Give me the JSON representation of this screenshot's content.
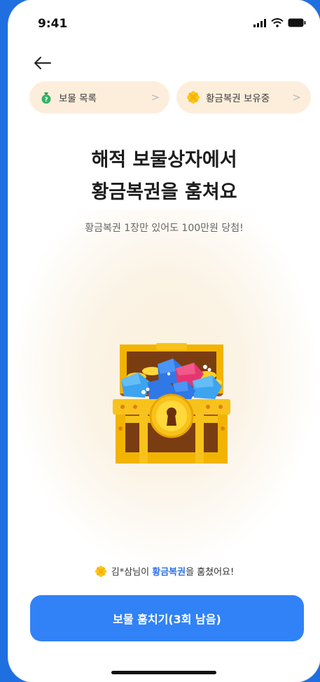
{
  "status_bar": {
    "time": "9:41"
  },
  "nav": {
    "back_icon": "back-arrow-icon"
  },
  "chips": [
    {
      "label": "보물 목록",
      "icon": "money-bag-icon",
      "chevron": ">"
    },
    {
      "label": "황금복권 보유중",
      "icon": "golden-ticket-icon",
      "chevron": ">"
    }
  ],
  "headline": {
    "line1": "해적 보물상자에서",
    "line2": "황금복권을 훔쳐요"
  },
  "subtitle": "황금복권 1장만 있어도 100만원 당첨!",
  "illustration": {
    "icon": "treasure-chest-icon"
  },
  "notice": {
    "prefix": "김*삼님이 ",
    "highlight": "황금복권",
    "suffix": "을 훔쳤어요!"
  },
  "cta": {
    "label": "보물 훔치기(3회 남음)"
  },
  "colors": {
    "primary": "#3182f6",
    "chip_bg": "#fdeedc",
    "highlight": "#2f6fe6",
    "background_edge": "#1f6fe0"
  }
}
